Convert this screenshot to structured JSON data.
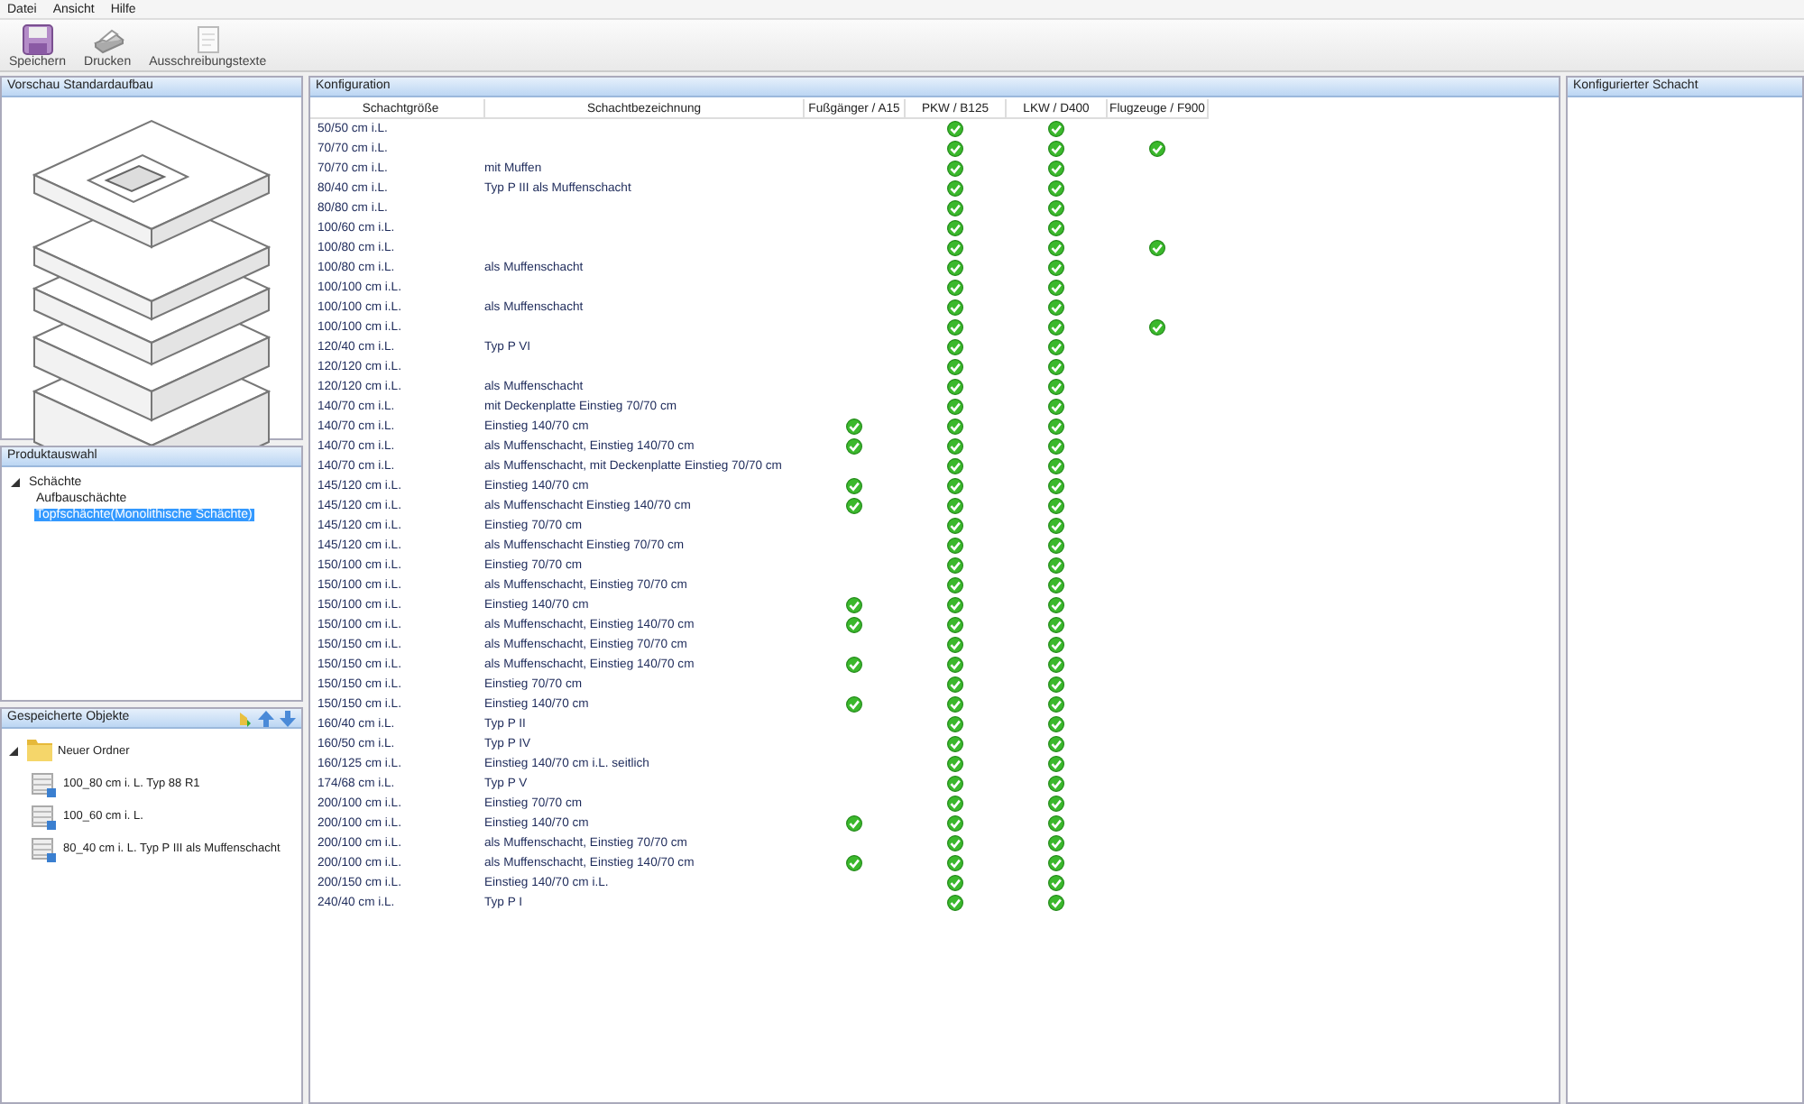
{
  "menu": [
    "Datei",
    "Ansicht",
    "Hilfe"
  ],
  "toolbar": [
    {
      "kind": "save",
      "label": "Speichern"
    },
    {
      "kind": "print",
      "label": "Drucken"
    },
    {
      "kind": "document",
      "label": "Ausschreibungstexte"
    }
  ],
  "preview": {
    "title": "Vorschau Standardaufbau"
  },
  "products": {
    "title": "Produktauswahl",
    "tree": [
      {
        "label": "Schächte",
        "expanded": true,
        "selected": false,
        "children": [
          {
            "label": "Aufbauschächte",
            "selected": false
          },
          {
            "label": "Topfschächte(Monolithische Schächte)",
            "selected": true
          }
        ]
      }
    ]
  },
  "saved": {
    "title": "Gespeicherte Objekte",
    "tree": [
      {
        "label": "Neuer Ordner",
        "kind": "folder",
        "expanded": true,
        "children": [
          {
            "label": "100_80 cm i. L. Typ 88 R1",
            "kind": "object"
          },
          {
            "label": "100_60 cm i. L.",
            "kind": "object"
          },
          {
            "label": "80_40 cm i. L. Typ P III als Muffenschacht",
            "kind": "object"
          }
        ]
      }
    ]
  },
  "config": {
    "title": "Konfiguration",
    "columns": [
      "Schachtgröße",
      "Schachtbezeichnung",
      "Fußgänger / A15",
      "PKW / B125",
      "LKW / D400",
      "Flugzeuge / F900"
    ],
    "rows": [
      {
        "size": "50/50 cm i.L.",
        "checks": [
          false,
          true,
          true,
          false
        ]
      },
      {
        "size": "70/70 cm i.L.",
        "checks": [
          false,
          true,
          true,
          true
        ]
      },
      {
        "size": "70/70 cm i.L.",
        "name": "mit Muffen",
        "checks": [
          false,
          true,
          true,
          false
        ]
      },
      {
        "size": "80/40 cm i.L.",
        "name": "Typ P III als Muffenschacht",
        "checks": [
          false,
          true,
          true,
          false
        ]
      },
      {
        "size": "80/80 cm i.L.",
        "checks": [
          false,
          true,
          true,
          false
        ]
      },
      {
        "size": "100/60 cm i.L.",
        "checks": [
          false,
          true,
          true,
          false
        ]
      },
      {
        "size": "100/80 cm i.L.",
        "checks": [
          false,
          true,
          true,
          true
        ]
      },
      {
        "size": "100/80 cm i.L.",
        "name": "als Muffenschacht",
        "checks": [
          false,
          true,
          true,
          false
        ]
      },
      {
        "size": "100/100 cm i.L.",
        "checks": [
          false,
          true,
          true,
          false
        ]
      },
      {
        "size": "100/100 cm i.L.",
        "name": "als Muffenschacht",
        "checks": [
          false,
          true,
          true,
          false
        ]
      },
      {
        "size": "100/100 cm i.L.",
        "checks": [
          false,
          true,
          true,
          true
        ]
      },
      {
        "size": "120/40 cm i.L.",
        "name": "Typ P VI",
        "checks": [
          false,
          true,
          true,
          false
        ]
      },
      {
        "size": "120/120 cm i.L.",
        "checks": [
          false,
          true,
          true,
          false
        ]
      },
      {
        "size": "120/120 cm i.L.",
        "name": "als Muffenschacht",
        "checks": [
          false,
          true,
          true,
          false
        ]
      },
      {
        "size": "140/70 cm i.L.",
        "name": "mit Deckenplatte Einstieg 70/70 cm",
        "checks": [
          false,
          true,
          true,
          false
        ]
      },
      {
        "size": "140/70 cm i.L.",
        "name": "Einstieg 140/70 cm",
        "checks": [
          true,
          true,
          true,
          false
        ]
      },
      {
        "size": "140/70 cm i.L.",
        "name": "als Muffenschacht, Einstieg 140/70 cm",
        "checks": [
          true,
          true,
          true,
          false
        ]
      },
      {
        "size": "140/70 cm i.L.",
        "name": "als Muffenschacht, mit Deckenplatte Einstieg 70/70 cm",
        "checks": [
          false,
          true,
          true,
          false
        ]
      },
      {
        "size": "145/120 cm i.L.",
        "name": "Einstieg 140/70 cm",
        "checks": [
          true,
          true,
          true,
          false
        ]
      },
      {
        "size": "145/120 cm i.L.",
        "name": "als Muffenschacht Einstieg 140/70 cm",
        "checks": [
          true,
          true,
          true,
          false
        ]
      },
      {
        "size": "145/120 cm i.L.",
        "name": "Einstieg 70/70 cm",
        "checks": [
          false,
          true,
          true,
          false
        ]
      },
      {
        "size": "145/120 cm i.L.",
        "name": "als Muffenschacht Einstieg 70/70 cm",
        "checks": [
          false,
          true,
          true,
          false
        ]
      },
      {
        "size": "150/100 cm i.L.",
        "name": "Einstieg 70/70 cm",
        "checks": [
          false,
          true,
          true,
          false
        ]
      },
      {
        "size": "150/100 cm i.L.",
        "name": "als Muffenschacht, Einstieg 70/70 cm",
        "checks": [
          false,
          true,
          true,
          false
        ]
      },
      {
        "size": "150/100 cm i.L.",
        "name": "Einstieg 140/70 cm",
        "checks": [
          true,
          true,
          true,
          false
        ]
      },
      {
        "size": "150/100 cm i.L.",
        "name": "als Muffenschacht, Einstieg 140/70 cm",
        "checks": [
          true,
          true,
          true,
          false
        ]
      },
      {
        "size": "150/150 cm i.L.",
        "name": "als Muffenschacht, Einstieg 70/70 cm",
        "checks": [
          false,
          true,
          true,
          false
        ]
      },
      {
        "size": "150/150 cm i.L.",
        "name": "als Muffenschacht, Einstieg 140/70 cm",
        "checks": [
          true,
          true,
          true,
          false
        ]
      },
      {
        "size": "150/150 cm i.L.",
        "name": "Einstieg 70/70 cm",
        "checks": [
          false,
          true,
          true,
          false
        ]
      },
      {
        "size": "150/150 cm i.L.",
        "name": "Einstieg 140/70 cm",
        "checks": [
          true,
          true,
          true,
          false
        ]
      },
      {
        "size": "160/40 cm i.L.",
        "name": "Typ P II",
        "checks": [
          false,
          true,
          true,
          false
        ]
      },
      {
        "size": "160/50 cm i.L.",
        "name": "Typ P IV",
        "checks": [
          false,
          true,
          true,
          false
        ]
      },
      {
        "size": "160/125 cm i.L.",
        "name": "Einstieg 140/70 cm i.L. seitlich",
        "checks": [
          false,
          true,
          true,
          false
        ]
      },
      {
        "size": "174/68 cm i.L.",
        "name": "Typ P V",
        "checks": [
          false,
          true,
          true,
          false
        ]
      },
      {
        "size": "200/100 cm i.L.",
        "name": "Einstieg 70/70 cm",
        "checks": [
          false,
          true,
          true,
          false
        ]
      },
      {
        "size": "200/100 cm i.L.",
        "name": "Einstieg 140/70 cm",
        "checks": [
          true,
          true,
          true,
          false
        ]
      },
      {
        "size": "200/100 cm i.L.",
        "name": "als Muffenschacht, Einstieg 70/70 cm",
        "checks": [
          false,
          true,
          true,
          false
        ]
      },
      {
        "size": "200/100 cm i.L.",
        "name": "als Muffenschacht, Einstieg 140/70 cm",
        "checks": [
          true,
          true,
          true,
          false
        ]
      },
      {
        "size": "200/150 cm i.L.",
        "name": "Einstieg 140/70 cm i.L.",
        "checks": [
          false,
          true,
          true,
          false
        ]
      },
      {
        "size": "240/40 cm i.L.",
        "name": "Typ P I",
        "checks": [
          false,
          true,
          true,
          false
        ]
      }
    ]
  },
  "result": {
    "title": "Konfigurierter Schacht"
  }
}
